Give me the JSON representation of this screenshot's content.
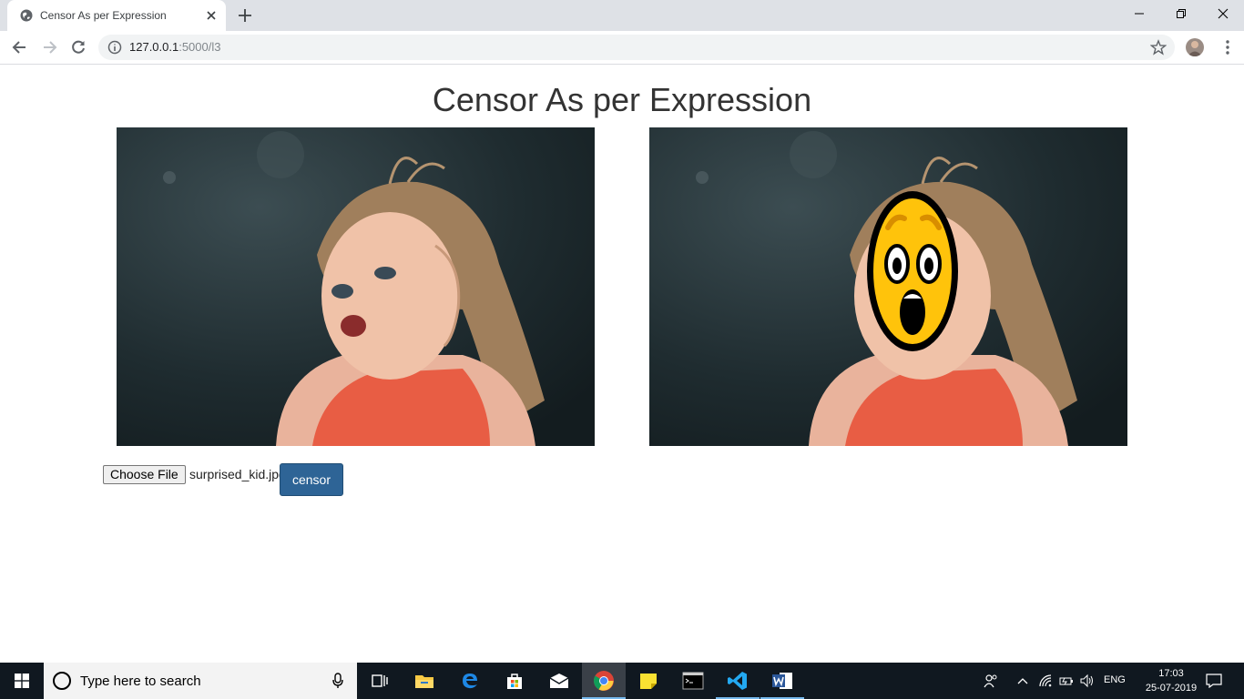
{
  "browser": {
    "tab_title": "Censor As per Expression",
    "url_host": "127.0.0.1",
    "url_path": ":5000/l3"
  },
  "page": {
    "title": "Censor As per Expression",
    "choose_file_label": "Choose File",
    "file_name": "surprised_kid.jpg",
    "censor_label": "censor"
  },
  "taskbar": {
    "search_placeholder": "Type here to search",
    "language": "ENG",
    "time": "17:03",
    "date": "25-07-2019"
  },
  "colors": {
    "censor_button": "#2e6496",
    "taskbar": "#101820",
    "tabstrip": "#dee1e6"
  }
}
